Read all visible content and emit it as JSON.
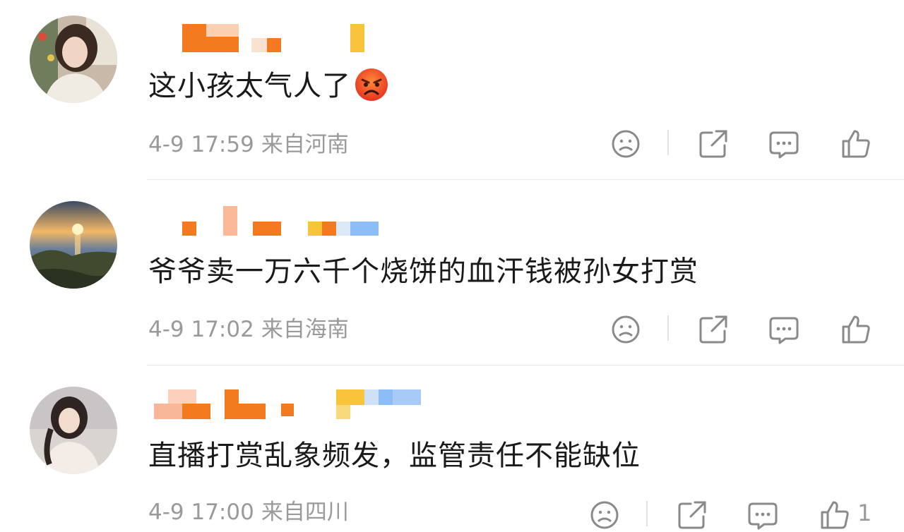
{
  "comments": [
    {
      "text": "这小孩太气人了",
      "emoji": "angry-face",
      "date": "4-9 17:59",
      "location": "来自河南",
      "like_count": ""
    },
    {
      "text": "爷爷卖一万六千个烧饼的血汗钱被孙女打赏",
      "date": "4-9 17:02",
      "location": "来自海南",
      "like_count": ""
    },
    {
      "text": "直播打赏乱象频发，监管责任不能缺位",
      "date": "4-9 17:00",
      "location": "来自四川",
      "like_count": "1"
    }
  ],
  "icons": {
    "dislike": "sad-face-icon",
    "share": "share-icon",
    "reply": "comment-icon",
    "like": "thumbs-up-icon"
  },
  "colors": {
    "text": "#1a1a1a",
    "meta": "#9a9a9a",
    "mosaic_orange": "#f47a20",
    "mosaic_blue": "#8cbcf5",
    "mosaic_yellow": "#f7c43a"
  }
}
